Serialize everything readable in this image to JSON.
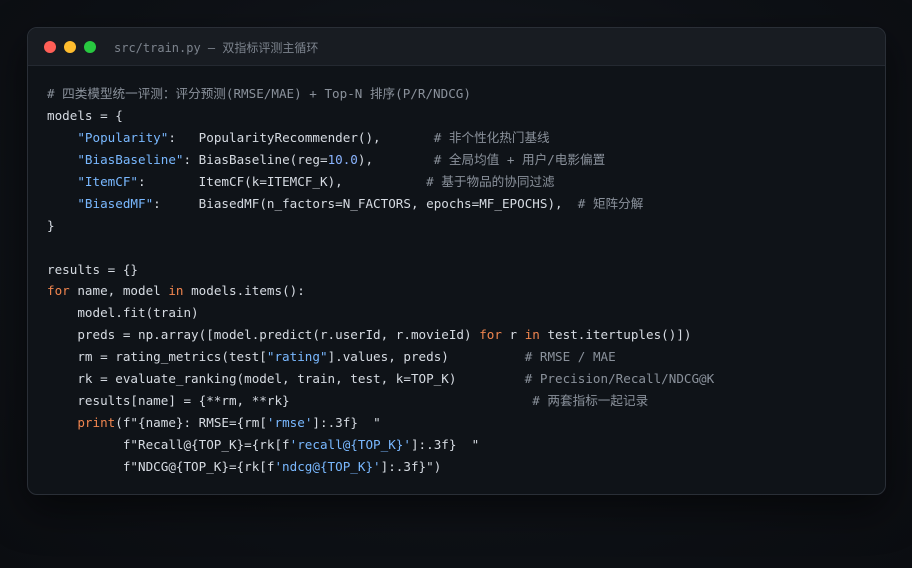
{
  "window": {
    "title": "src/train.py — 双指标评测主循环"
  },
  "colors": {
    "background": "#0e1116",
    "window": "#0f1318",
    "titlebar": "#181c22",
    "close": "#ff5f57",
    "minimize": "#febc2e",
    "maximize": "#28c840",
    "text": "#d6dbe2",
    "comment": "#8a919b",
    "keyword": "#f0854f",
    "string": "#79b8ff",
    "number": "#8ab4ff"
  },
  "code": {
    "lines": [
      [
        {
          "t": "comment",
          "v": "# 四类模型统一评测：评分预测(RMSE/MAE) + Top-N 排序(P/R/NDCG)"
        }
      ],
      [
        {
          "t": "plain",
          "v": "models = {"
        }
      ],
      [
        {
          "t": "plain",
          "v": "    "
        },
        {
          "t": "string",
          "v": "\"Popularity\""
        },
        {
          "t": "plain",
          "v": ":   PopularityRecommender(),       "
        },
        {
          "t": "comment",
          "v": "# 非个性化热门基线"
        }
      ],
      [
        {
          "t": "plain",
          "v": "    "
        },
        {
          "t": "string",
          "v": "\"BiasBaseline\""
        },
        {
          "t": "plain",
          "v": ": BiasBaseline(reg="
        },
        {
          "t": "number",
          "v": "10.0"
        },
        {
          "t": "plain",
          "v": "),        "
        },
        {
          "t": "comment",
          "v": "# 全局均值 + 用户/电影偏置"
        }
      ],
      [
        {
          "t": "plain",
          "v": "    "
        },
        {
          "t": "string",
          "v": "\"ItemCF\""
        },
        {
          "t": "plain",
          "v": ":       ItemCF(k=ITEMCF_K),           "
        },
        {
          "t": "comment",
          "v": "# 基于物品的协同过滤"
        }
      ],
      [
        {
          "t": "plain",
          "v": "    "
        },
        {
          "t": "string",
          "v": "\"BiasedMF\""
        },
        {
          "t": "plain",
          "v": ":     BiasedMF(n_factors=N_FACTORS, epochs=MF_EPOCHS),  "
        },
        {
          "t": "comment",
          "v": "# 矩阵分解"
        }
      ],
      [
        {
          "t": "plain",
          "v": "}"
        }
      ],
      [
        {
          "t": "plain",
          "v": ""
        }
      ],
      [
        {
          "t": "plain",
          "v": "results = {}"
        }
      ],
      [
        {
          "t": "keyword",
          "v": "for"
        },
        {
          "t": "plain",
          "v": " name, model "
        },
        {
          "t": "keyword",
          "v": "in"
        },
        {
          "t": "plain",
          "v": " models.items():"
        }
      ],
      [
        {
          "t": "plain",
          "v": "    model.fit(train)"
        }
      ],
      [
        {
          "t": "plain",
          "v": "    preds = np.array([model.predict(r.userId, r.movieId) "
        },
        {
          "t": "keyword",
          "v": "for"
        },
        {
          "t": "plain",
          "v": " r "
        },
        {
          "t": "keyword",
          "v": "in"
        },
        {
          "t": "plain",
          "v": " test.itertuples()])"
        }
      ],
      [
        {
          "t": "plain",
          "v": "    rm = rating_metrics(test["
        },
        {
          "t": "string",
          "v": "\"rating\""
        },
        {
          "t": "plain",
          "v": "].values, preds)          "
        },
        {
          "t": "comment",
          "v": "# RMSE / MAE"
        }
      ],
      [
        {
          "t": "plain",
          "v": "    rk = evaluate_ranking(model, train, test, k=TOP_K)         "
        },
        {
          "t": "comment",
          "v": "# Precision/Recall/NDCG@K"
        }
      ],
      [
        {
          "t": "plain",
          "v": "    results[name] = {**rm, **rk}                                "
        },
        {
          "t": "comment",
          "v": "# 两套指标一起记录"
        }
      ],
      [
        {
          "t": "plain",
          "v": "    "
        },
        {
          "t": "keyword",
          "v": "print"
        },
        {
          "t": "plain",
          "v": "(f\"{name}: RMSE={rm["
        },
        {
          "t": "string",
          "v": "'rmse'"
        },
        {
          "t": "plain",
          "v": "]:.3f}  \""
        }
      ],
      [
        {
          "t": "plain",
          "v": "          f\"Recall@{TOP_K}={rk[f"
        },
        {
          "t": "string",
          "v": "'recall@{TOP_K}'"
        },
        {
          "t": "plain",
          "v": "]:.3f}  \""
        }
      ],
      [
        {
          "t": "plain",
          "v": "          f\"NDCG@{TOP_K}={rk[f"
        },
        {
          "t": "string",
          "v": "'ndcg@{TOP_K}'"
        },
        {
          "t": "plain",
          "v": "]:.3f}\")"
        }
      ]
    ]
  }
}
